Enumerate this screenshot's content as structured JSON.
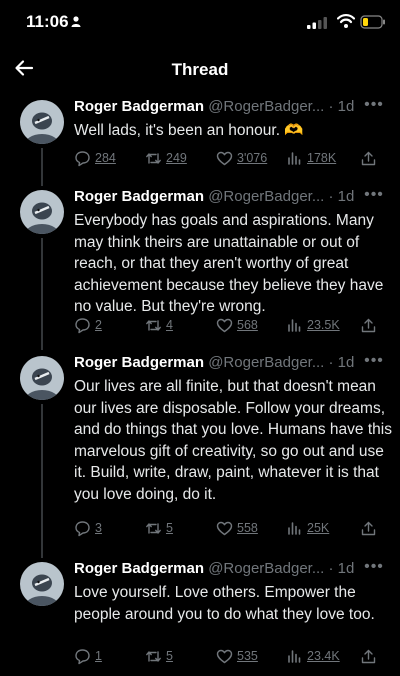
{
  "status_bar": {
    "time": "11:06"
  },
  "header": {
    "title": "Thread"
  },
  "tweets": [
    {
      "name": "Roger Badgerman",
      "handle": "@RogerBadger... · 1d",
      "text": "Well lads, it's been an honour. 🫶",
      "replies": "284",
      "retweets": "249",
      "likes": "3'076",
      "views": "178K"
    },
    {
      "name": "Roger Badgerman",
      "handle": "@RogerBadger... · 1d",
      "text": "Everybody has goals and aspirations. Many may think theirs are unattainable or out of reach, or that they aren't worthy of great achievement because they believe they have no value. But they're wrong.",
      "replies": "2",
      "retweets": "4",
      "likes": "568",
      "views": "23.5K"
    },
    {
      "name": "Roger Badgerman",
      "handle": "@RogerBadger... · 1d",
      "text": "Our lives are all finite, but that doesn't mean our lives are disposable. Follow your dreams, and do things that you love. Humans have this marvelous gift of creativity, so go out and use it. Build, write, draw, paint, whatever it is that you love doing, do it.",
      "replies": "3",
      "retweets": "5",
      "likes": "558",
      "views": "25K"
    },
    {
      "name": "Roger Badgerman",
      "handle": "@RogerBadger... · 1d",
      "text": "Love yourself. Love others. Empower the people around you to do what they love too.",
      "replies": "1",
      "retweets": "5",
      "likes": "535",
      "views": "23.4K"
    }
  ]
}
